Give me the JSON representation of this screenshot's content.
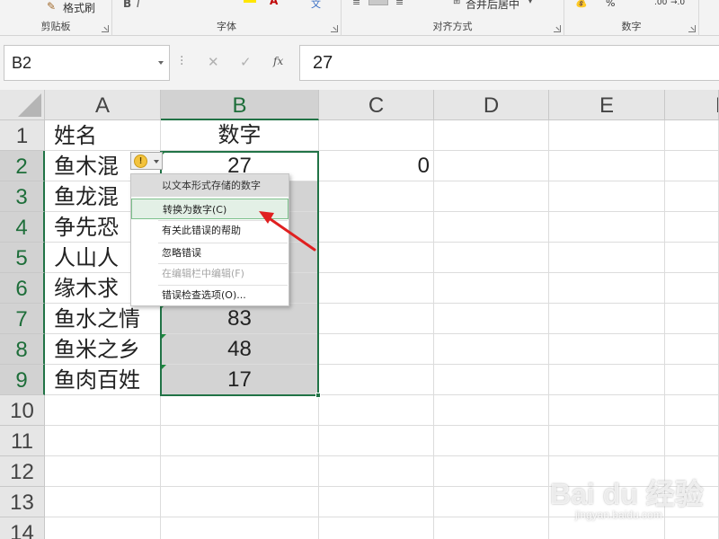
{
  "ribbon": {
    "format_painter": "格式刷",
    "groups": {
      "clipboard": "剪贴板",
      "font": "字体",
      "alignment": "对齐方式",
      "number": "数字"
    },
    "merge_center": "合并后居中",
    "percent": "%",
    "decimal_left": ".00",
    "decimal_right": "→.0"
  },
  "formula_bar": {
    "name_box": "B2",
    "fx": "fx",
    "cancel": "✕",
    "confirm": "✓",
    "value": "27"
  },
  "columns": [
    "A",
    "B",
    "C",
    "D",
    "E",
    "F"
  ],
  "rows": [
    "1",
    "2",
    "3",
    "4",
    "5",
    "6",
    "7",
    "8",
    "9",
    "10",
    "11",
    "12",
    "13",
    "14"
  ],
  "cells": {
    "A1": "姓名",
    "B1": "数字",
    "A2": "鱼木混",
    "B2": "27",
    "C2": "0",
    "A3": "鱼龙混",
    "A4": "争先恐",
    "A5": "人山人",
    "A6": "缘木求",
    "A7": "鱼水之情",
    "B7": "83",
    "A8": "鱼米之乡",
    "B8": "48",
    "A9": "鱼肉百姓",
    "B9": "17"
  },
  "error_menu": {
    "header": "以文本形式存储的数字",
    "items": [
      "转换为数字(C)",
      "有关此错误的帮助",
      "忽略错误",
      "在编辑栏中编辑(F)",
      "错误检查选项(O)..."
    ]
  },
  "watermark": {
    "main": "Bai du 经验",
    "sub": "jingyan.baidu.com"
  },
  "colors": {
    "accent": "#217346",
    "arrow": "#e02020",
    "selection_fill": "#d3d3d3",
    "warning": "#f3c33d"
  }
}
